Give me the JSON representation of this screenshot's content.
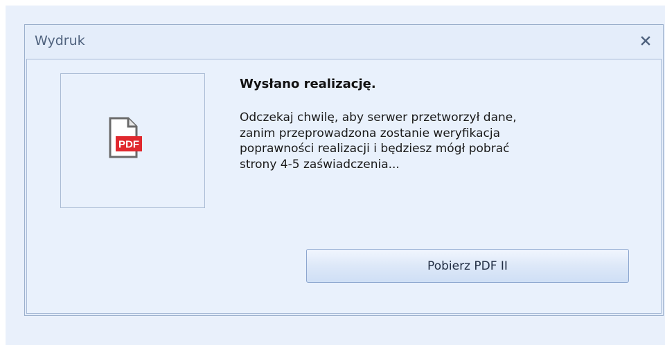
{
  "dialog": {
    "title": "Wydruk",
    "close_label": "x"
  },
  "message": {
    "heading": "Wysłano realizację.",
    "body_lines": [
      "Odczekaj chwilę, aby serwer przetworzył dane,",
      "zanim przeprowadzona zostanie weryfikacja",
      "poprawności realizacji i będziesz mógł pobrać",
      "strony 4-5 zaświadczenia..."
    ]
  },
  "icon": {
    "name": "pdf-file-icon",
    "badge_text": "PDF",
    "badge_color": "#e0282e"
  },
  "buttons": {
    "download_label": "Pobierz PDF II"
  },
  "colors": {
    "title_text": "#4f627e",
    "background": "#e4edfa"
  }
}
